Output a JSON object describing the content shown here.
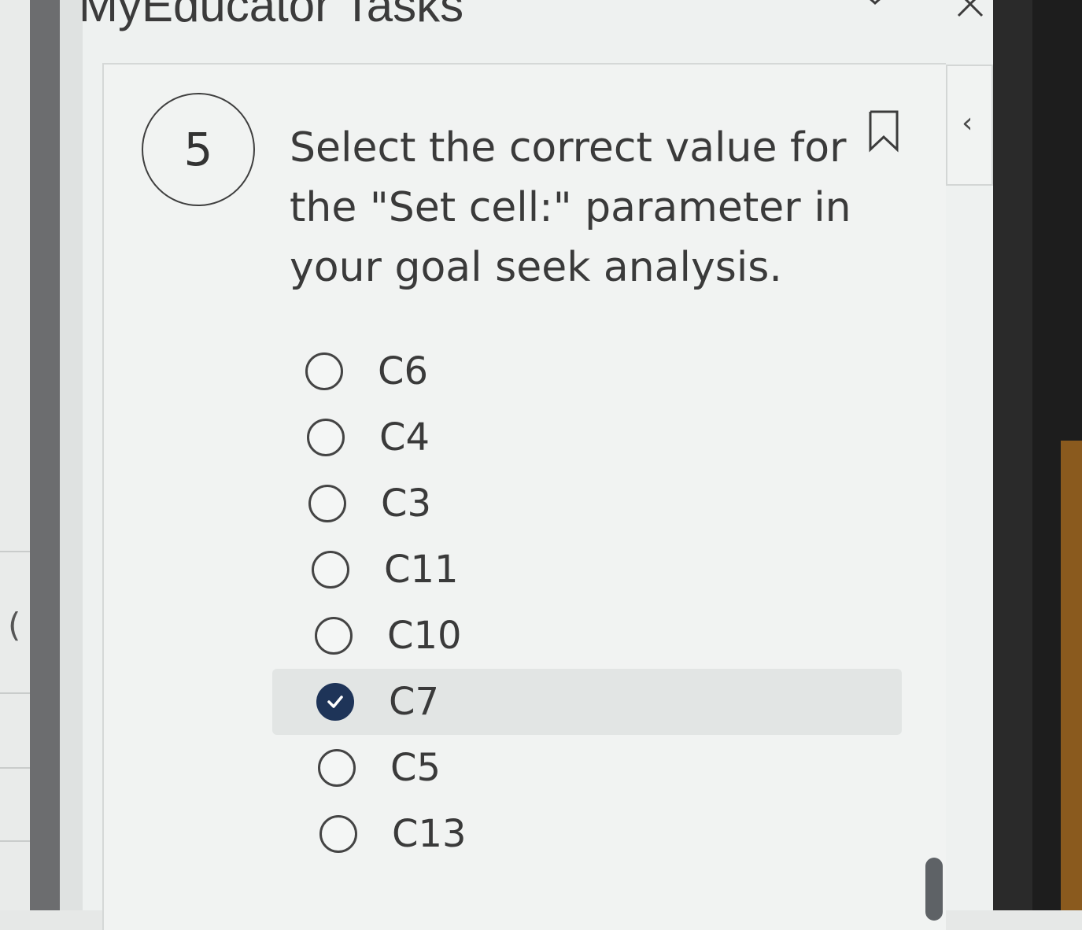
{
  "header": {
    "title": "MyEducator Tasks"
  },
  "question": {
    "number": "5",
    "text": "Select the correct value for the \"Set cell:\" parameter in your goal seek analysis."
  },
  "options": [
    {
      "label": "C6",
      "selected": false
    },
    {
      "label": "C4",
      "selected": false
    },
    {
      "label": "C3",
      "selected": false
    },
    {
      "label": "C11",
      "selected": false
    },
    {
      "label": "C10",
      "selected": false
    },
    {
      "label": "C7",
      "selected": true
    },
    {
      "label": "C5",
      "selected": false
    },
    {
      "label": "C13",
      "selected": false
    }
  ],
  "side_panel": {
    "left_glyph": "(",
    "collapse_glyph": "‹"
  },
  "colors": {
    "accent": "#1e3458",
    "selected_row": "#e2e5e4"
  }
}
